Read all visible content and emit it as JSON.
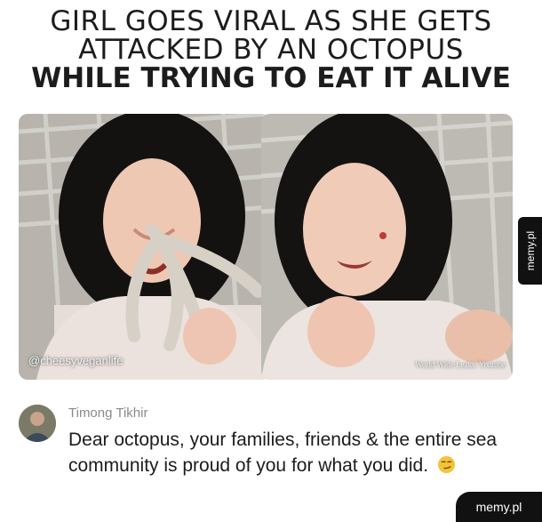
{
  "headline": {
    "line1": "GIRL GOES VIRAL AS SHE GETS",
    "line2": "ATTACKED BY AN OCTOPUS",
    "line3": "WHILE TRYING TO EAT IT ALIVE"
  },
  "photos": {
    "left_watermark": "@cheesyveganlife",
    "right_watermark": "World Wide Leaks/ Youtube"
  },
  "side_tab": {
    "label": "memy.pl"
  },
  "comment": {
    "username": "Timong Tikhir",
    "text": "Dear octopus, your families, friends & the entire sea community is proud of you for what you did.",
    "emoji_icon": "smirking-face-icon"
  },
  "corner_badge": {
    "label": "memy.pl"
  }
}
